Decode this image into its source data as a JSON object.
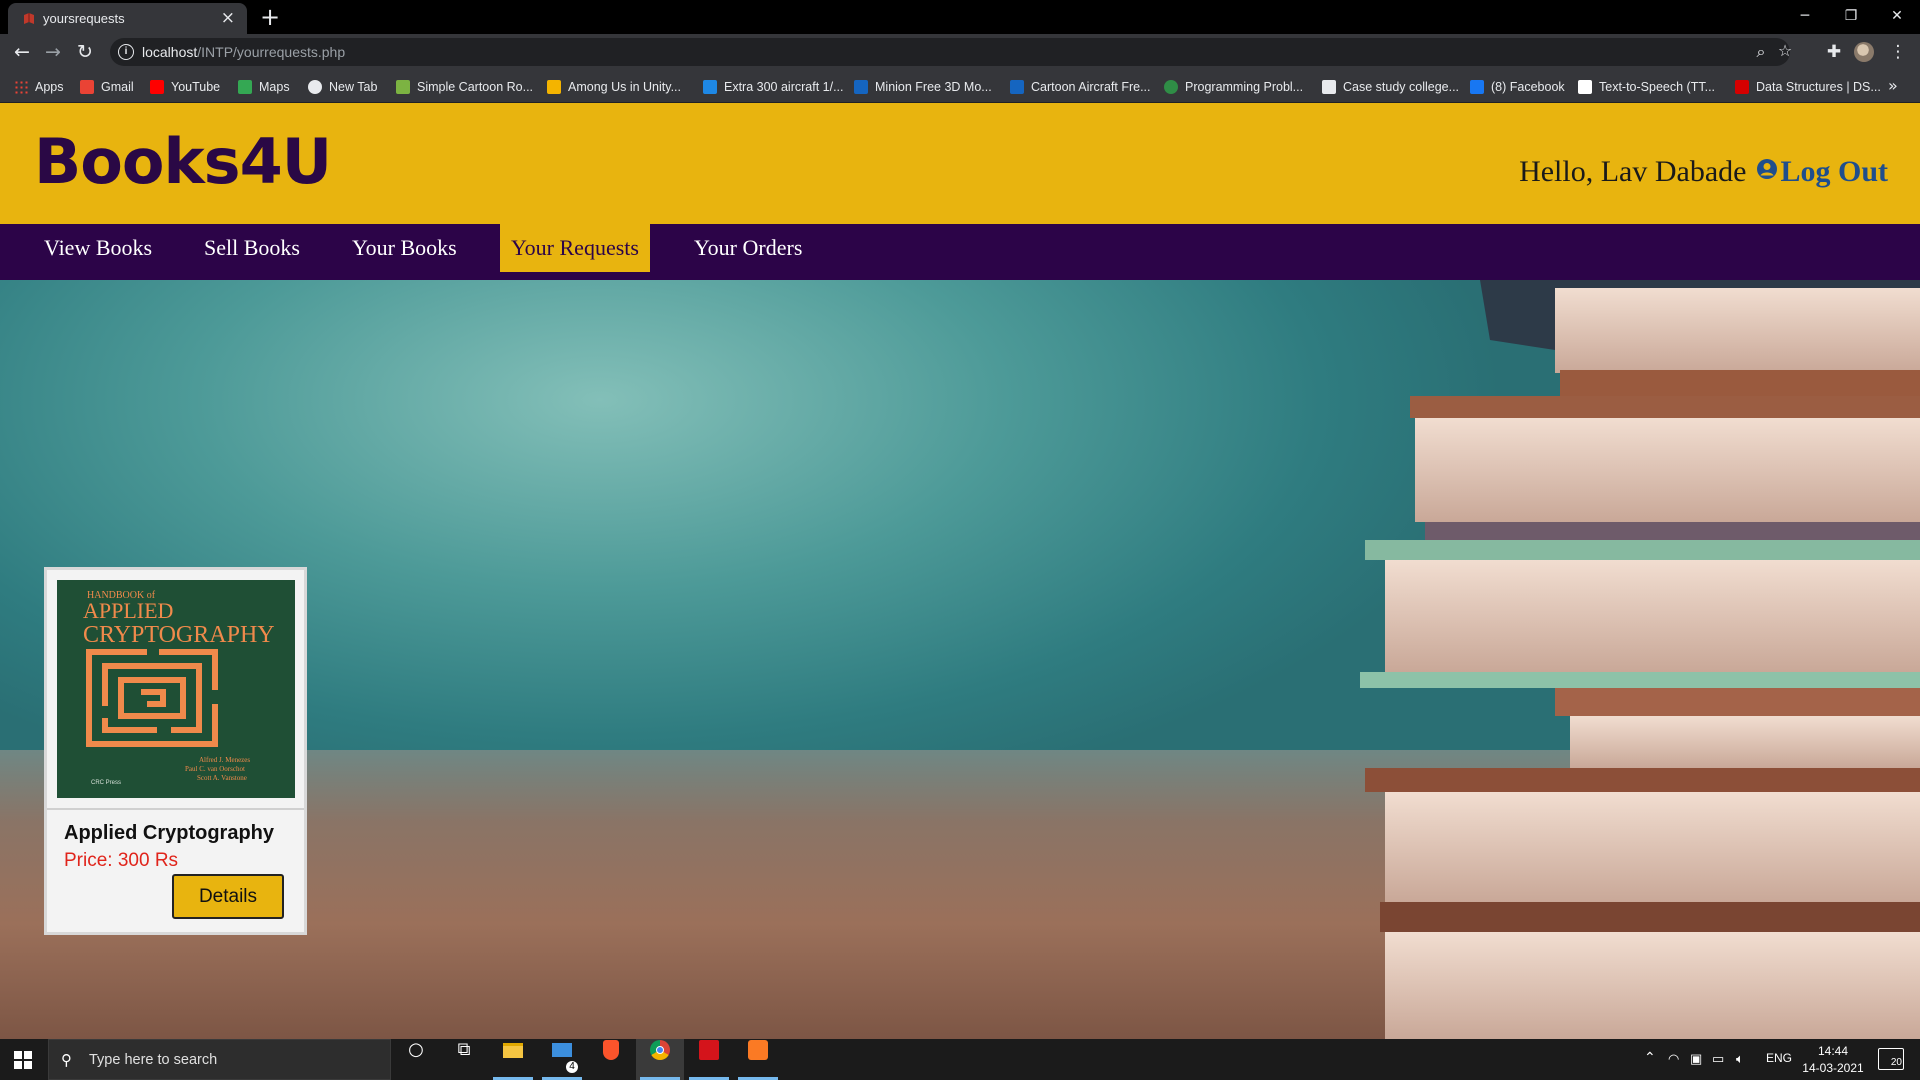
{
  "browser": {
    "tab_title": "yoursrequests",
    "url_host": "localhost",
    "url_path": "/INTP/yourrequests.php"
  },
  "bookmarks": [
    {
      "label": "Apps",
      "icon": "apps-grid-icon",
      "color": "#4285f4"
    },
    {
      "label": "Gmail",
      "icon": "gmail-icon",
      "color": "#ea4335"
    },
    {
      "label": "YouTube",
      "icon": "youtube-icon",
      "color": "#ff0000"
    },
    {
      "label": "Maps",
      "icon": "maps-icon",
      "color": "#34a853"
    },
    {
      "label": "New Tab",
      "icon": "globe-icon",
      "color": "#e8eaed"
    },
    {
      "label": "Simple Cartoon Ro...",
      "icon": "site-icon",
      "color": "#7cb342"
    },
    {
      "label": "Among Us in Unity...",
      "icon": "site-icon",
      "color": "#f4b400"
    },
    {
      "label": "Extra 300 aircraft 1/...",
      "icon": "site-icon",
      "color": "#1e88e5"
    },
    {
      "label": "Minion Free 3D Mo...",
      "icon": "3d-icon",
      "color": "#1565c0"
    },
    {
      "label": "Cartoon Aircraft Fre...",
      "icon": "3d-icon",
      "color": "#1565c0"
    },
    {
      "label": "Programming Probl...",
      "icon": "gfg-icon",
      "color": "#2f8d46"
    },
    {
      "label": "Case study college...",
      "icon": "site-icon",
      "color": "#e8eaed"
    },
    {
      "label": "(8) Facebook",
      "icon": "facebook-icon",
      "color": "#1877f2"
    },
    {
      "label": "Text-to-Speech (TT...",
      "icon": "site-icon",
      "color": "#ffffff"
    },
    {
      "label": "Data Structures | DS...",
      "icon": "site-icon",
      "color": "#d50000"
    }
  ],
  "site": {
    "logo": "Books4U",
    "greeting": "Hello, Lav Dabade",
    "logout_label": "Log Out",
    "nav": [
      {
        "label": "View Books",
        "active": false
      },
      {
        "label": "Sell Books",
        "active": false
      },
      {
        "label": "Your Books",
        "active": false
      },
      {
        "label": "Your Requests",
        "active": true
      },
      {
        "label": "Your Orders",
        "active": false
      }
    ],
    "colors": {
      "header": "#e8b40f",
      "navbar": "#2c0448",
      "logo": "#2a0845",
      "price": "#e0241b"
    }
  },
  "requests": [
    {
      "title": "Applied Cryptography",
      "price": "Price: 300 Rs",
      "button_label": "Details",
      "cover_text": {
        "line1": "HANDBOOK of",
        "line2": "APPLIED",
        "line3": "CRYPTOGRAPHY",
        "authors": [
          "Alfred J. Menezes",
          "Paul C. van Oorschot",
          "Scott A. Vanstone"
        ],
        "publisher": "CRC Press"
      }
    }
  ],
  "taskbar": {
    "search_placeholder": "Type here to search",
    "mail_badge": "4",
    "language": "ENG",
    "time": "14:44",
    "date": "14-03-2021",
    "notifications": "20"
  }
}
